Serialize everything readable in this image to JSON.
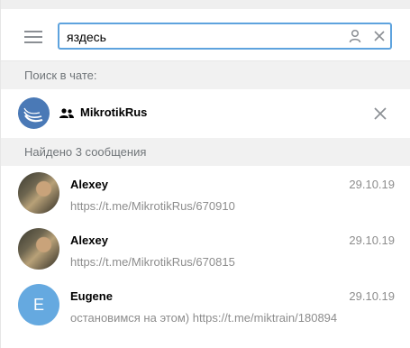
{
  "search": {
    "value": "яздесь"
  },
  "sections": {
    "search_in_chat": "Поиск в чате:",
    "found": "Найдено 3 сообщения"
  },
  "chat": {
    "name": "MikrotikRus"
  },
  "results": [
    {
      "name": "Alexey",
      "date": "29.10.19",
      "text": "https://t.me/MikrotikRus/670910",
      "avatar": "photo"
    },
    {
      "name": "Alexey",
      "date": "29.10.19",
      "text": "https://t.me/MikrotikRus/670815",
      "avatar": "photo"
    },
    {
      "name": "Eugene",
      "date": "29.10.19",
      "text": "остановимся на этом)  https://t.me/miktrain/180894",
      "avatar_letter": "E"
    }
  ],
  "colors": {
    "accent": "#5ea3de",
    "letter_avatar": "#65a9e0",
    "section_bg": "#f1f1f1"
  }
}
